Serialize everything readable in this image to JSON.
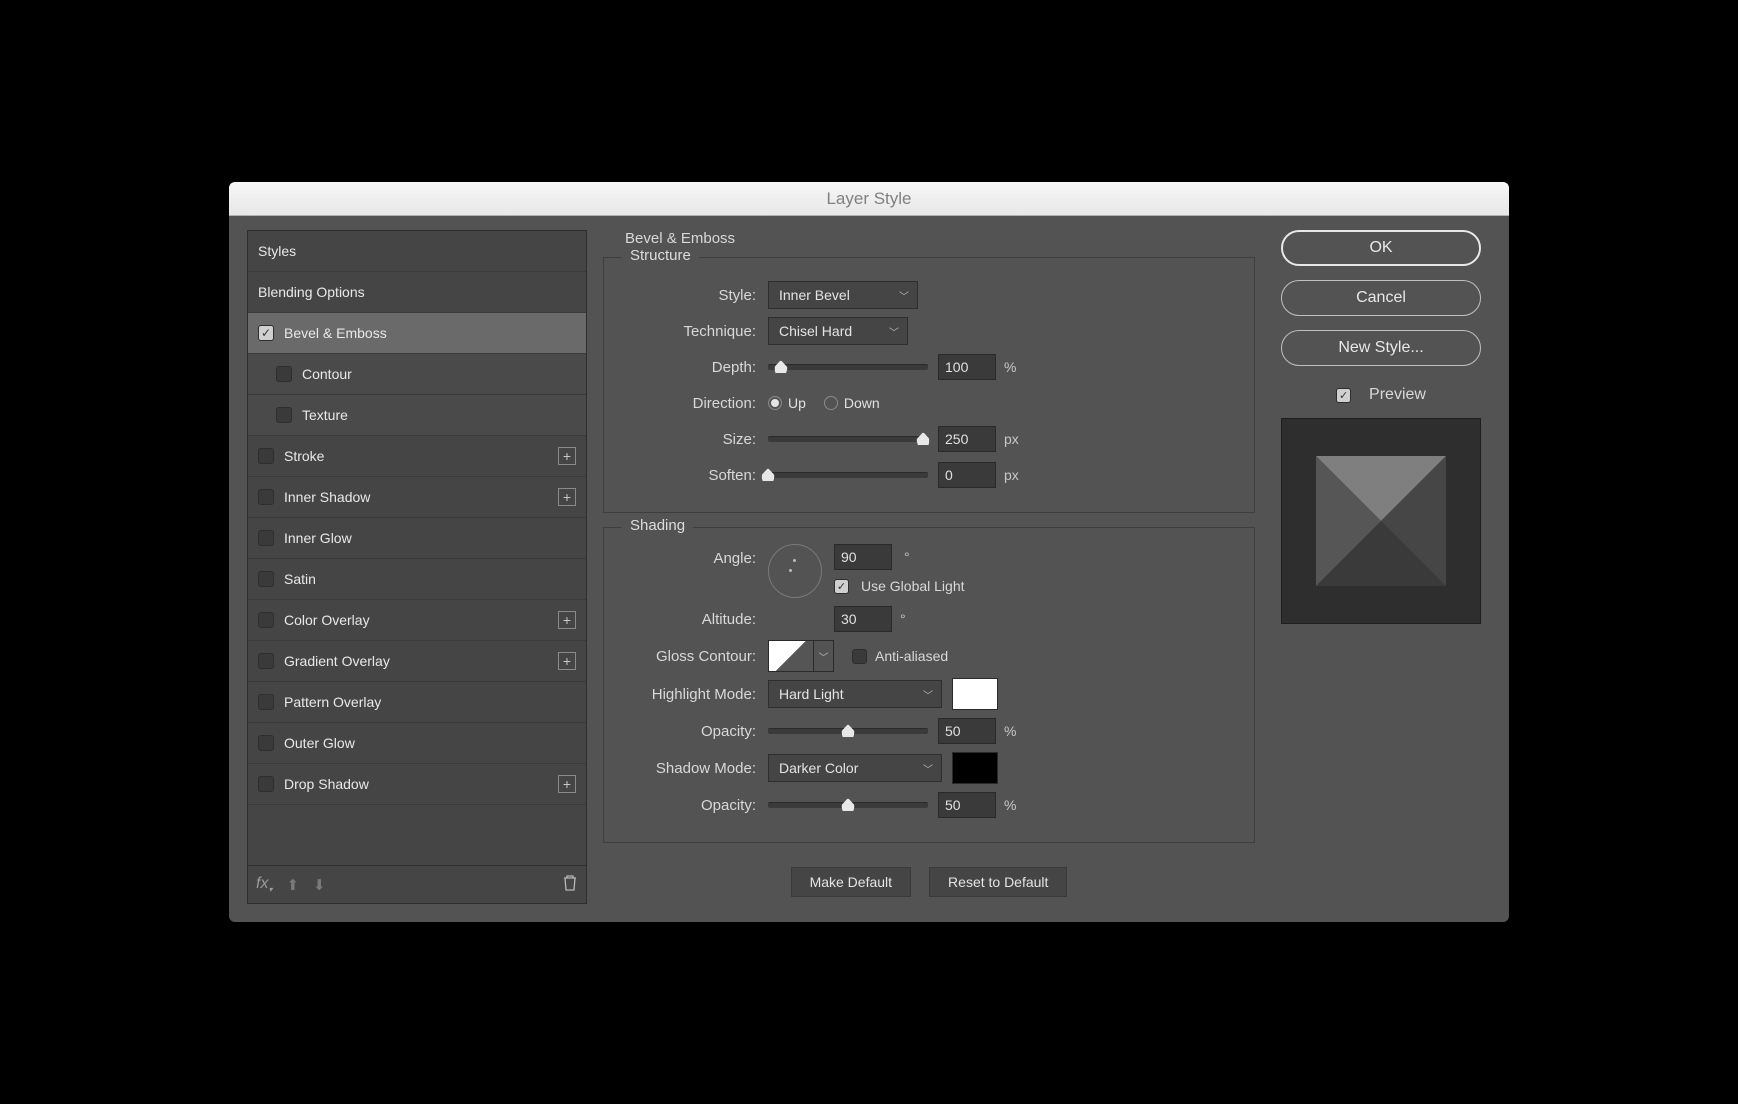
{
  "window": {
    "title": "Layer Style"
  },
  "sidebar": {
    "styles_header": "Styles",
    "blending_options": "Blending Options",
    "items": [
      {
        "label": "Bevel & Emboss",
        "checked": true,
        "selected": true
      },
      {
        "label": "Contour",
        "checked": false,
        "sub": true
      },
      {
        "label": "Texture",
        "checked": false,
        "sub": true
      },
      {
        "label": "Stroke",
        "checked": false,
        "plus": true
      },
      {
        "label": "Inner Shadow",
        "checked": false,
        "plus": true
      },
      {
        "label": "Inner Glow",
        "checked": false
      },
      {
        "label": "Satin",
        "checked": false
      },
      {
        "label": "Color Overlay",
        "checked": false,
        "plus": true
      },
      {
        "label": "Gradient Overlay",
        "checked": false,
        "plus": true
      },
      {
        "label": "Pattern Overlay",
        "checked": false
      },
      {
        "label": "Outer Glow",
        "checked": false
      },
      {
        "label": "Drop Shadow",
        "checked": false,
        "plus": true
      }
    ],
    "fx_label": "fx"
  },
  "panel": {
    "title": "Bevel & Emboss",
    "structure": {
      "legend": "Structure",
      "style_label": "Style:",
      "style_value": "Inner Bevel",
      "technique_label": "Technique:",
      "technique_value": "Chisel Hard",
      "depth_label": "Depth:",
      "depth_value": "100",
      "depth_unit": "%",
      "direction_label": "Direction:",
      "direction_up": "Up",
      "direction_down": "Down",
      "size_label": "Size:",
      "size_value": "250",
      "size_unit": "px",
      "soften_label": "Soften:",
      "soften_value": "0",
      "soften_unit": "px"
    },
    "shading": {
      "legend": "Shading",
      "angle_label": "Angle:",
      "angle_value": "90",
      "angle_unit": "°",
      "use_global": "Use Global Light",
      "use_global_on": true,
      "altitude_label": "Altitude:",
      "altitude_value": "30",
      "altitude_unit": "°",
      "gloss_label": "Gloss Contour:",
      "antialiased": "Anti-aliased",
      "antialiased_on": false,
      "highlight_mode_label": "Highlight Mode:",
      "highlight_mode_value": "Hard Light",
      "highlight_color": "#ffffff",
      "highlight_opacity_label": "Opacity:",
      "highlight_opacity_value": "50",
      "highlight_opacity_unit": "%",
      "shadow_mode_label": "Shadow Mode:",
      "shadow_mode_value": "Darker Color",
      "shadow_color": "#000000",
      "shadow_opacity_label": "Opacity:",
      "shadow_opacity_value": "50",
      "shadow_opacity_unit": "%"
    },
    "make_default": "Make Default",
    "reset_default": "Reset to Default"
  },
  "buttons": {
    "ok": "OK",
    "cancel": "Cancel",
    "new_style": "New Style...",
    "preview": "Preview",
    "preview_on": true
  }
}
